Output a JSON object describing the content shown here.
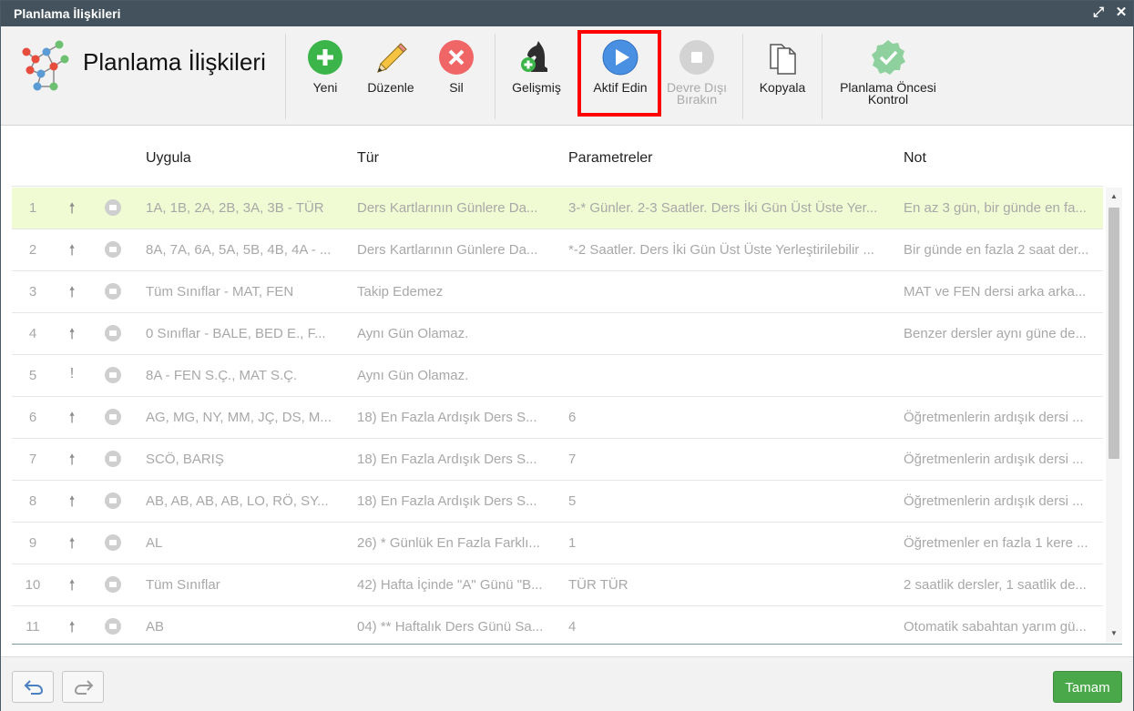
{
  "window": {
    "title": "Planlama İlişkileri"
  },
  "header": {
    "title": "Planlama İlişkileri"
  },
  "toolbar": {
    "new": "Yeni",
    "edit": "Düzenle",
    "delete": "Sil",
    "advanced": "Gelişmiş",
    "activate": "Aktif Edin",
    "deactivate_l1": "Devre Dışı",
    "deactivate_l2": "Bırakın",
    "copy": "Kopyala",
    "precheck_l1": "Planlama Öncesi",
    "precheck_l2": "Kontrol"
  },
  "columns": {
    "apply": "Uygula",
    "type": "Tür",
    "params": "Parametreler",
    "note": "Not"
  },
  "rows": [
    {
      "num": "1",
      "dir": "🠕",
      "apply": "1A, 1B, 2A, 2B, 3A, 3B - TÜR",
      "type": "Ders Kartlarının Günlere Da...",
      "params": "3-* Günler. 2-3 Saatler. Ders İki Gün Üst Üste Yer...",
      "note": "En az 3 gün, bir günde en fa..."
    },
    {
      "num": "2",
      "dir": "🠕",
      "apply": "8A, 7A, 6A, 5A, 5B, 4B, 4A - ...",
      "type": "Ders Kartlarının Günlere Da...",
      "params": "*-2 Saatler. Ders İki Gün Üst Üste Yerleştirilebilir ...",
      "note": "Bir günde en fazla 2 saat der..."
    },
    {
      "num": "3",
      "dir": "🠕",
      "apply": "Tüm Sınıflar - MAT, FEN",
      "type": "Takip Edemez",
      "params": "",
      "note": "MAT ve FEN dersi arka arka..."
    },
    {
      "num": "4",
      "dir": "🠕",
      "apply": "0 Sınıflar - BALE, BED E., F...",
      "type": "Aynı Gün Olamaz.",
      "params": "",
      "note": "Benzer dersler aynı güne de..."
    },
    {
      "num": "5",
      "dir": "!",
      "apply": "8A - FEN S.Ç., MAT S.Ç.",
      "type": "Aynı Gün Olamaz.",
      "params": "",
      "note": ""
    },
    {
      "num": "6",
      "dir": "🠕",
      "apply": "AG, MG, NY, MM, JÇ, DS, M...",
      "type": "18) En Fazla Ardışık Ders S...",
      "params": "6",
      "note": "Öğretmenlerin ardışık dersi ..."
    },
    {
      "num": "7",
      "dir": "🠕",
      "apply": "SCÖ, BARIŞ",
      "type": "18) En Fazla Ardışık Ders S...",
      "params": "7",
      "note": "Öğretmenlerin ardışık dersi ..."
    },
    {
      "num": "8",
      "dir": "🠕",
      "apply": "AB, AB, AB, AB, LO, RÖ, SY...",
      "type": "18) En Fazla Ardışık Ders S...",
      "params": "5",
      "note": "Öğretmenlerin ardışık dersi ..."
    },
    {
      "num": "9",
      "dir": "🠕",
      "apply": "AL",
      "type": "26) * Günlük En Fazla Farklı...",
      "params": "1",
      "note": "Öğretmenler en fazla 1 kere ..."
    },
    {
      "num": "10",
      "dir": "🠕",
      "apply": "Tüm Sınıflar",
      "type": "42) Hafta İçinde \"A\" Günü \"B...",
      "params": "TÜR TÜR",
      "note": "2 saatlik dersler, 1 saatlik de..."
    },
    {
      "num": "11",
      "dir": "🠕",
      "apply": "AB",
      "type": "04) ** Haftalık Ders Günü Sa...",
      "params": "4",
      "note": "Otomatik sabahtan yarım gü..."
    }
  ],
  "footer": {
    "ok": "Tamam"
  }
}
